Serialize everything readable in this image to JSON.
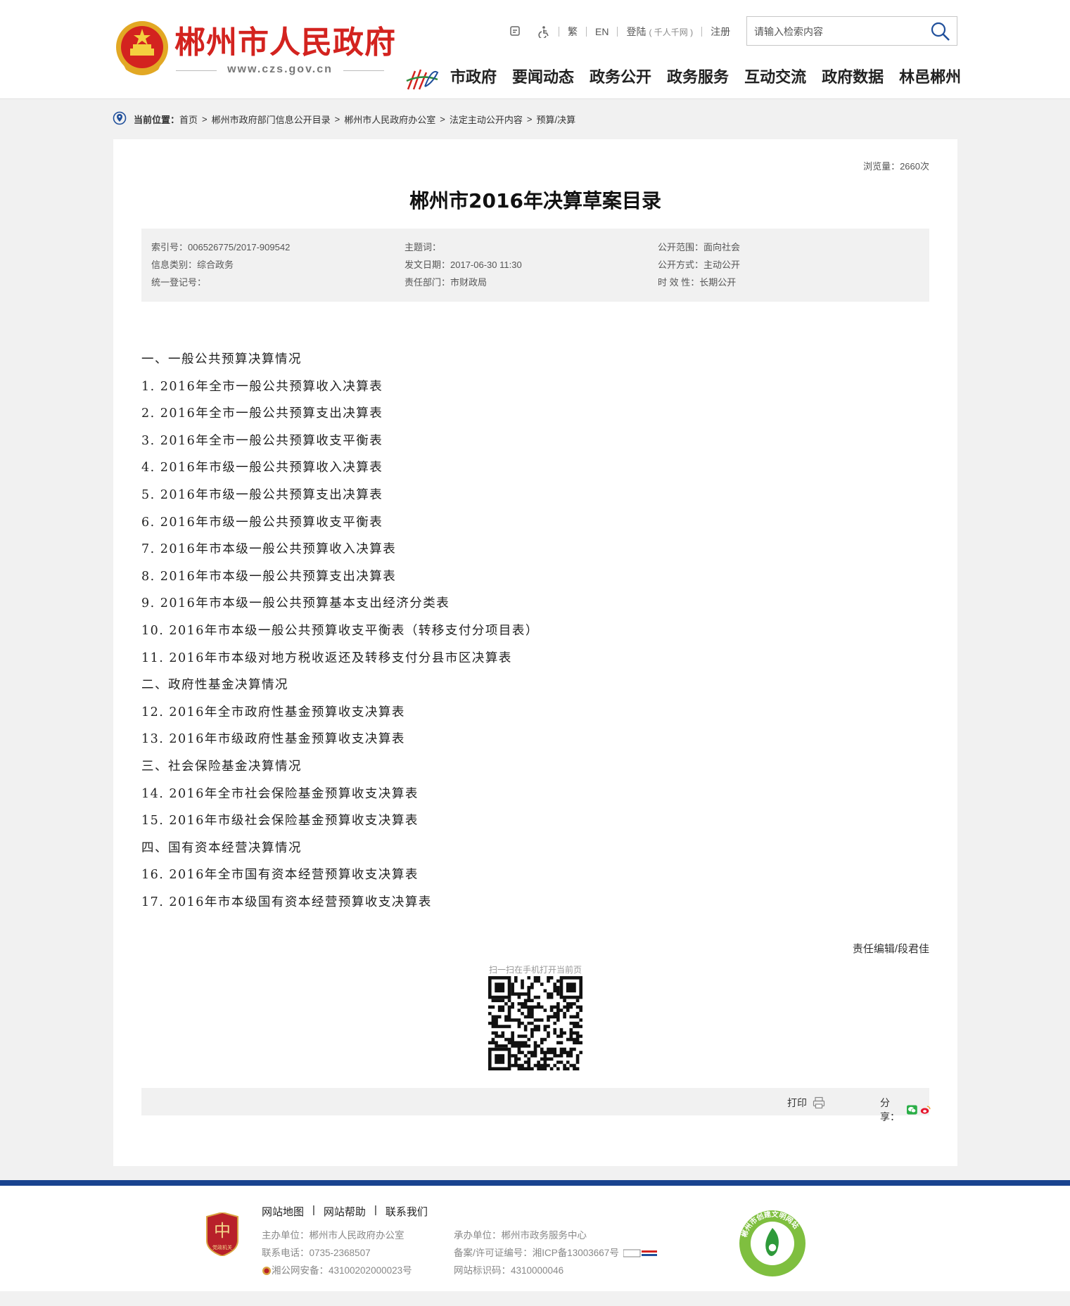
{
  "header": {
    "site_title": "郴州市人民政府",
    "site_url": "www.czs.gov.cn",
    "toplinks": {
      "traditional": "繁",
      "english": "EN",
      "login": "登陆",
      "login_note": "( 千人千网 )",
      "register": "注册"
    },
    "search_placeholder": "请输入检索内容",
    "nav": [
      "市政府",
      "要闻动态",
      "政务公开",
      "政务服务",
      "互动交流",
      "政府数据",
      "林邑郴州"
    ]
  },
  "breadcrumb": {
    "label": "当前位置：",
    "items": [
      "首页",
      "郴州市政府部门信息公开目录",
      "郴州市人民政府办公室",
      "法定主动公开内容",
      "预算/决算"
    ],
    "separator": ">"
  },
  "article": {
    "views": "浏览量：2660次",
    "title": "郴州市2016年决算草案目录",
    "meta": {
      "index_no": "索引号：006526775/2017-909542",
      "subject": "主题词：",
      "scope": "公开范围：面向社会",
      "category": "信息类别：综合政务",
      "date": "发文日期：2017-06-30 11:30",
      "method": "公开方式：主动公开",
      "reg_no": "统一登记号：",
      "dept": "责任部门：市财政局",
      "validity": "时 效 性：长期公开"
    },
    "lines": [
      "一、一般公共预算决算情况",
      "1. 2016年全市一般公共预算收入决算表",
      "2. 2016年全市一般公共预算支出决算表",
      "3. 2016年全市一般公共预算收支平衡表",
      "4. 2016年市级一般公共预算收入决算表",
      "5. 2016年市级一般公共预算支出决算表",
      "6. 2016年市级一般公共预算收支平衡表",
      "7. 2016年市本级一般公共预算收入决算表",
      "8. 2016年市本级一般公共预算支出决算表",
      "9. 2016年市本级一般公共预算基本支出经济分类表",
      "10. 2016年市本级一般公共预算收支平衡表（转移支付分项目表）",
      "11. 2016年市本级对地方税收返还及转移支付分县市区决算表",
      "二、政府性基金决算情况",
      "12. 2016年全市政府性基金预算收支决算表",
      "13. 2016年市级政府性基金预算收支决算表",
      "三、社会保险基金决算情况",
      "14. 2016年全市社会保险基金预算收支决算表",
      "15. 2016年市级社会保险基金预算收支决算表",
      "四、国有资本经营决算情况",
      "16. 2016年全市国有资本经营预算收支决算表",
      "17. 2016年市本级国有资本经营预算收支决算表"
    ],
    "editor": "责任编辑/段君佳",
    "qr_caption": "扫一扫在手机打开当前页",
    "print_label": "打印",
    "share_label": "分享："
  },
  "footer": {
    "links": [
      "网站地图",
      "网站帮助",
      "联系我们"
    ],
    "host": "主办单位：郴州市人民政府办公室",
    "phone": "联系电话：0735-2368507",
    "police": "湘公网安备：43100202000023号",
    "undertaker": "承办单位：郴州市政务服务中心",
    "icp": "备案/许可证编号：湘ICP备13003667号",
    "site_id": "网站标识码：4310000046",
    "badge_text": "党政机关",
    "wenming_text": "郴州市创建文明网站"
  },
  "colors": {
    "title_red": "#d3231f",
    "footer_blue": "#19438f",
    "meta_bg": "#f1f1f1"
  }
}
